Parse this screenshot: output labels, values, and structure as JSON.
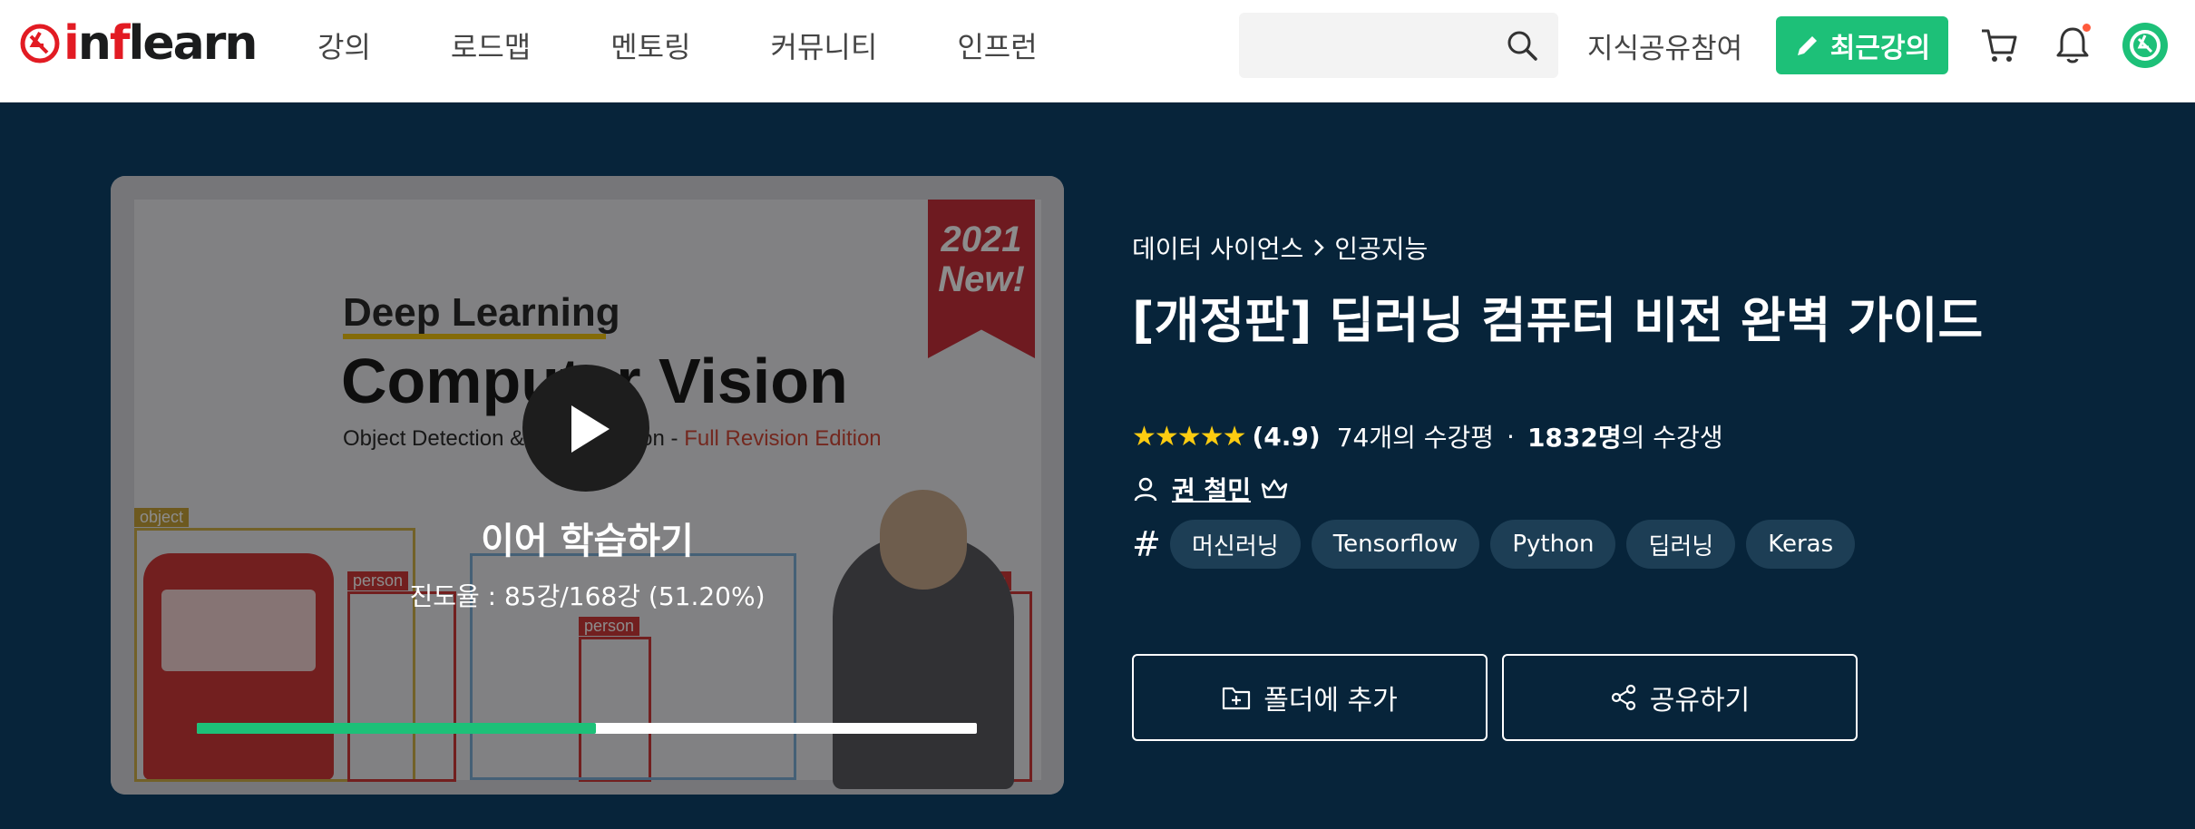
{
  "header": {
    "logo_text": "inflearn",
    "nav": [
      "강의",
      "로드맵",
      "멘토링",
      "커뮤니티",
      "인프런"
    ],
    "search": {
      "placeholder": ""
    },
    "share_knowledge": "지식공유참여",
    "recent_courses": "최근강의"
  },
  "thumbnail": {
    "cover_line1": "Deep Learning",
    "cover_line2": "Computer Vision",
    "cover_sub_a": "Object Detection & Segmentation - ",
    "cover_sub_b": "Full Revision Edition",
    "ribbon_year": "2021",
    "ribbon_new": "New!",
    "label_object": "object",
    "label_person_1": "person",
    "label_person_2": "person",
    "label_person_3": "person",
    "continue_label": "이어 학습하기",
    "progress_text": "진도율 : 85강/168강 (51.20%)",
    "progress_fraction": 0.512
  },
  "course": {
    "breadcrumb": [
      "데이터 사이언스",
      "인공지능"
    ],
    "title": "[개정판] 딥러닝 컴퓨터 비전 완벽 가이드",
    "stars": "★★★★★",
    "rating": "(4.9)",
    "reviews": "74개의 수강평",
    "students_count": "1832명",
    "students_suffix": "의 수강생",
    "instructor": "권 철민",
    "tags": [
      "머신러닝",
      "Tensorflow",
      "Python",
      "딥러닝",
      "Keras"
    ],
    "add_folder": "폴더에 추가",
    "share": "공유하기"
  },
  "colors": {
    "brand_green": "#1dc078",
    "hero_bg": "#07243a",
    "star": "#fdcc11"
  }
}
